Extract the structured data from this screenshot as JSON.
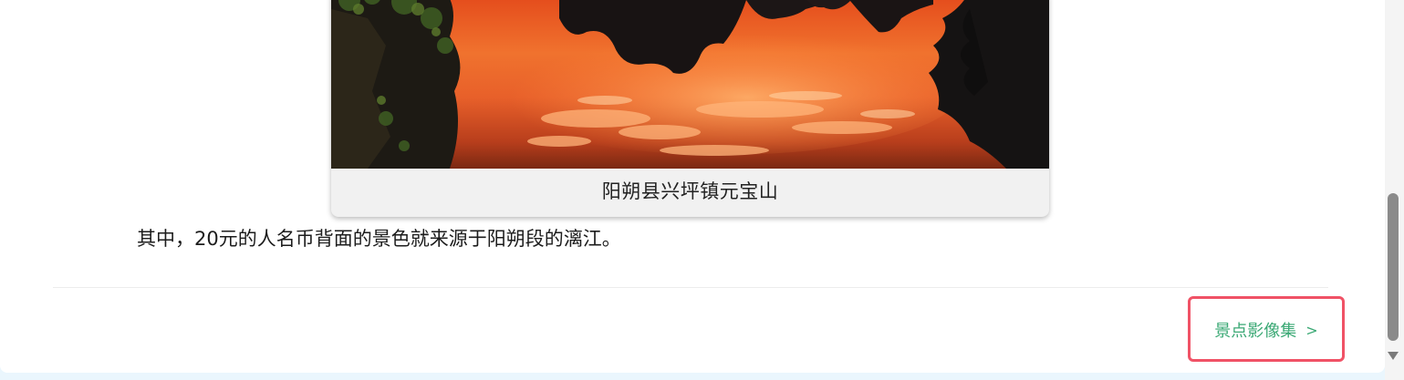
{
  "figure": {
    "caption": "阳朔县兴坪镇元宝山",
    "image_icon": "landscape-photo-sunset-reflection"
  },
  "article": {
    "paragraph": "其中，20元的人名币背面的景色就来源于阳朔段的漓江。"
  },
  "navigation": {
    "next_label": "景点影像集",
    "next_chevron": ">",
    "chevron_icon": "chevron-right-icon"
  },
  "colors": {
    "link_green": "#3aa874",
    "highlight_red": "#f05266",
    "background_blue": "#eaf6fd"
  }
}
